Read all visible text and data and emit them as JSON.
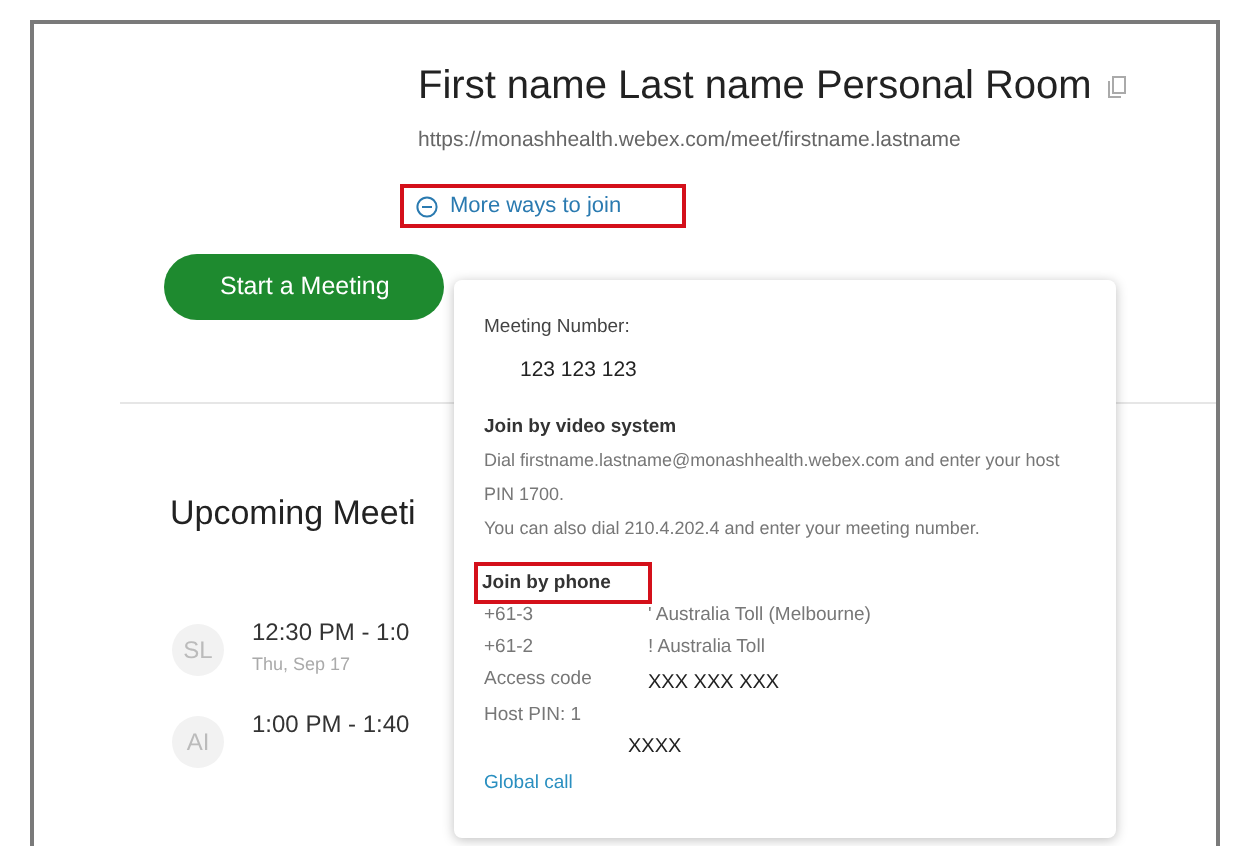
{
  "room": {
    "title": "First name Last name Personal Room",
    "url": "https://monashhealth.webex.com/meet/firstname.lastname",
    "more_link": {
      "label": "More ways to join",
      "highlighted": true
    }
  },
  "start_button": "Start a Meeting",
  "upcoming": {
    "heading": "Upcoming Meeti",
    "meetings": [
      {
        "initials": "SL",
        "time": "12:30 PM - 1:0",
        "date": "Thu, Sep 17"
      },
      {
        "initials": "AI",
        "time": "1:00 PM - 1:40"
      }
    ]
  },
  "popup": {
    "number_label": "Meeting Number:",
    "number": "123 123 123",
    "video": {
      "heading": "Join by video system",
      "lines": [
        "Dial firstname.lastname@monashhealth.webex.com and enter your host PIN 1700.",
        "You can also dial 210.4.202.4 and enter your meeting number."
      ]
    },
    "phone": {
      "heading": "Join by phone",
      "highlighted": true,
      "numbers": [
        {
          "number": "+61-3",
          "label": "' Australia Toll (Melbourne)"
        },
        {
          "number": "+61-2",
          "label": "! Australia Toll"
        }
      ],
      "access_label": "Access code",
      "access_value": "XXX XXX XXX",
      "pin_label": "Host PIN: 1",
      "pin_value": "XXXX",
      "global_link": "Global call"
    }
  }
}
